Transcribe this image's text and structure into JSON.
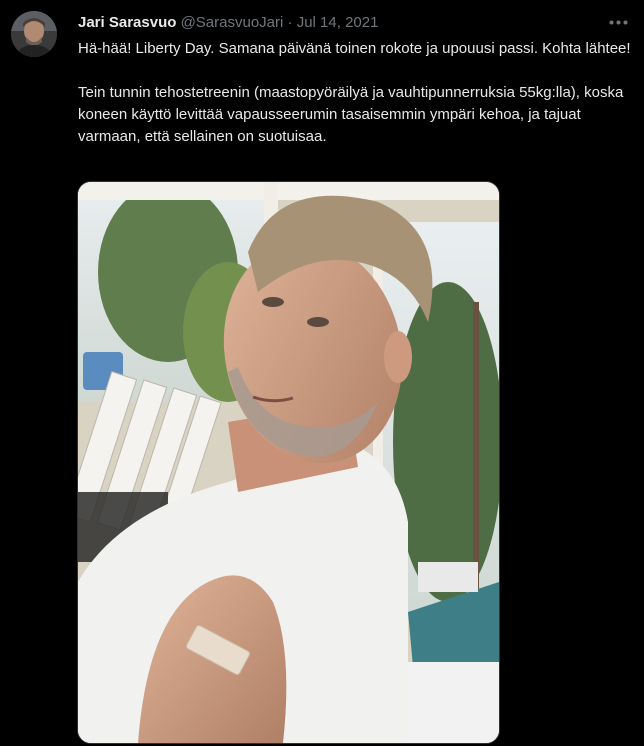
{
  "tweet": {
    "author_name": "Jari Sarasvuo",
    "handle": "@SarasvuoJari",
    "separator": "·",
    "date": "Jul 14, 2021",
    "paragraph1": "Hä-hää! Liberty Day. Samana päivänä toinen rokote ja upouusi passi. Kohta lähtee!",
    "paragraph2": "Tein tunnin tehostetreenin (maastopyöräilyä ja vauhtipunnerruksia 55kg:lla), koska koneen käyttö levittää vapausseerumin tasaisemmin ympäri kehoa, ja tajuat varmaan, että sellainen on suotuisaa.",
    "more_icon": "more-horizontal-icon"
  }
}
